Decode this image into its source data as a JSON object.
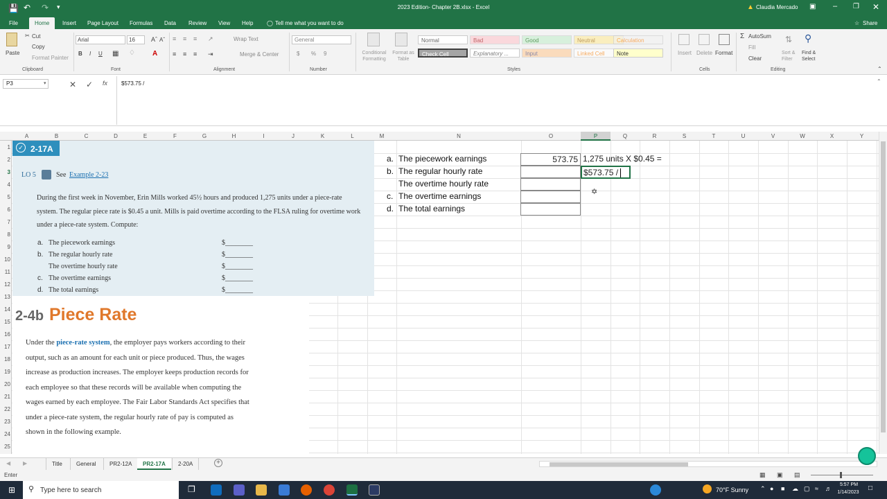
{
  "title_bar": {
    "doc_title": "2023 Edition- Chapter 2B.xlsx - Excel",
    "user": "Claudia Mercado"
  },
  "ribbon_tabs": [
    "File",
    "Home",
    "Insert",
    "Page Layout",
    "Formulas",
    "Data",
    "Review",
    "View",
    "Help"
  ],
  "tell_me": "Tell me what you want to do",
  "share": "Share",
  "clipboard": {
    "paste": "Paste",
    "cut": "Cut",
    "copy": "Copy",
    "format_painter": "Format Painter",
    "label": "Clipboard"
  },
  "font": {
    "name": "Arial",
    "size": "16",
    "bold": "B",
    "italic": "I",
    "underline": "U",
    "label": "Font"
  },
  "alignment": {
    "wrap": "Wrap Text",
    "merge": "Merge & Center",
    "label": "Alignment"
  },
  "number": {
    "format": "General",
    "currency": "$",
    "percent": "%",
    "comma": "9",
    "label": "Number"
  },
  "styles": {
    "conditional": "Conditional Formatting",
    "format_table": "Format as Table",
    "label": "Styles",
    "items": [
      "Normal",
      "Bad",
      "Good",
      "Neutral",
      "Calculation",
      "Check Cell",
      "Explanatory ...",
      "Input",
      "Linked Cell",
      "Note"
    ]
  },
  "cells": {
    "insert": "Insert",
    "delete": "Delete",
    "format": "Format",
    "label": "Cells"
  },
  "editing": {
    "autosum": "AutoSum",
    "fill": "Fill",
    "clear": "Clear",
    "sort": "Sort & Filter",
    "find": "Find & Select",
    "label": "Editing"
  },
  "name_box": "P3",
  "formula": "$573.75 /",
  "columns": [
    "A",
    "B",
    "C",
    "D",
    "E",
    "F",
    "G",
    "H",
    "I",
    "J",
    "K",
    "L",
    "M",
    "N",
    "O",
    "P",
    "Q",
    "R",
    "S",
    "T",
    "U",
    "V",
    "W",
    "X",
    "Y"
  ],
  "rows": [
    "1",
    "2",
    "3",
    "4",
    "5",
    "6",
    "7",
    "8",
    "9",
    "10",
    "11",
    "12",
    "13",
    "14",
    "15",
    "16",
    "17",
    "18",
    "19",
    "20",
    "21",
    "22",
    "23",
    "24",
    "25"
  ],
  "textbook": {
    "problem_id": "2-17A",
    "lo": "LO 5",
    "see": "See",
    "example_link": "Example 2-23",
    "intro": "During the first week in November, Erin Mills worked 45½ hours and produced 1,275 units under a piece-rate system. The regular piece rate is $0.45 a unit. Mills is paid overtime according to the FLSA ruling for overtime work under a piece-rate system. Compute:",
    "items": [
      {
        "letter": "a.",
        "text": "The piecework earnings",
        "blank": "$________"
      },
      {
        "letter": "b.",
        "text": "The regular hourly rate",
        "blank": "$________"
      },
      {
        "letter": "",
        "text": "The overtime hourly rate",
        "blank": "$________"
      },
      {
        "letter": "c.",
        "text": "The overtime earnings",
        "blank": "$________"
      },
      {
        "letter": "d.",
        "text": "The total earnings",
        "blank": "$________"
      }
    ]
  },
  "section": {
    "number": "2-4b",
    "title": "Piece Rate",
    "body_pre": "Under the ",
    "body_term": "piece-rate system",
    "lines": [
      ", the employer pays workers according to their",
      "output, such as an amount for each unit or piece produced. Thus, the wages",
      "increase as production increases. The employer keeps production records for",
      "each employee so that these records will be available when computing the",
      "wages earned by each employee. The Fair Labor Standards Act specifies that",
      "under a piece-rate system, the regular hourly rate of pay is computed as",
      "shown in the following example."
    ]
  },
  "worksheet": {
    "tasks": [
      {
        "letter": "a.",
        "label": "The piecework earnings",
        "value": "573.75"
      },
      {
        "letter": "b.",
        "label": "The regular hourly rate",
        "value": ""
      },
      {
        "letter": "",
        "label": "The overtime hourly rate",
        "value": ""
      },
      {
        "letter": "c.",
        "label": "The overtime earnings",
        "value": ""
      },
      {
        "letter": "d.",
        "label": "The total earnings",
        "value": ""
      }
    ],
    "p2_note": "1,275 units X $0.45  =",
    "p3_edit": "$573.75 / "
  },
  "sheet_tabs": [
    "Title",
    "General",
    "PR2-12A",
    "PR2-17A",
    "2-20A"
  ],
  "active_sheet": "PR2-17A",
  "status": "Enter",
  "taskbar": {
    "search": "Type here to search",
    "weather": "70°F  Sunny",
    "time": "5:57 PM",
    "date": "1/14/2023"
  }
}
